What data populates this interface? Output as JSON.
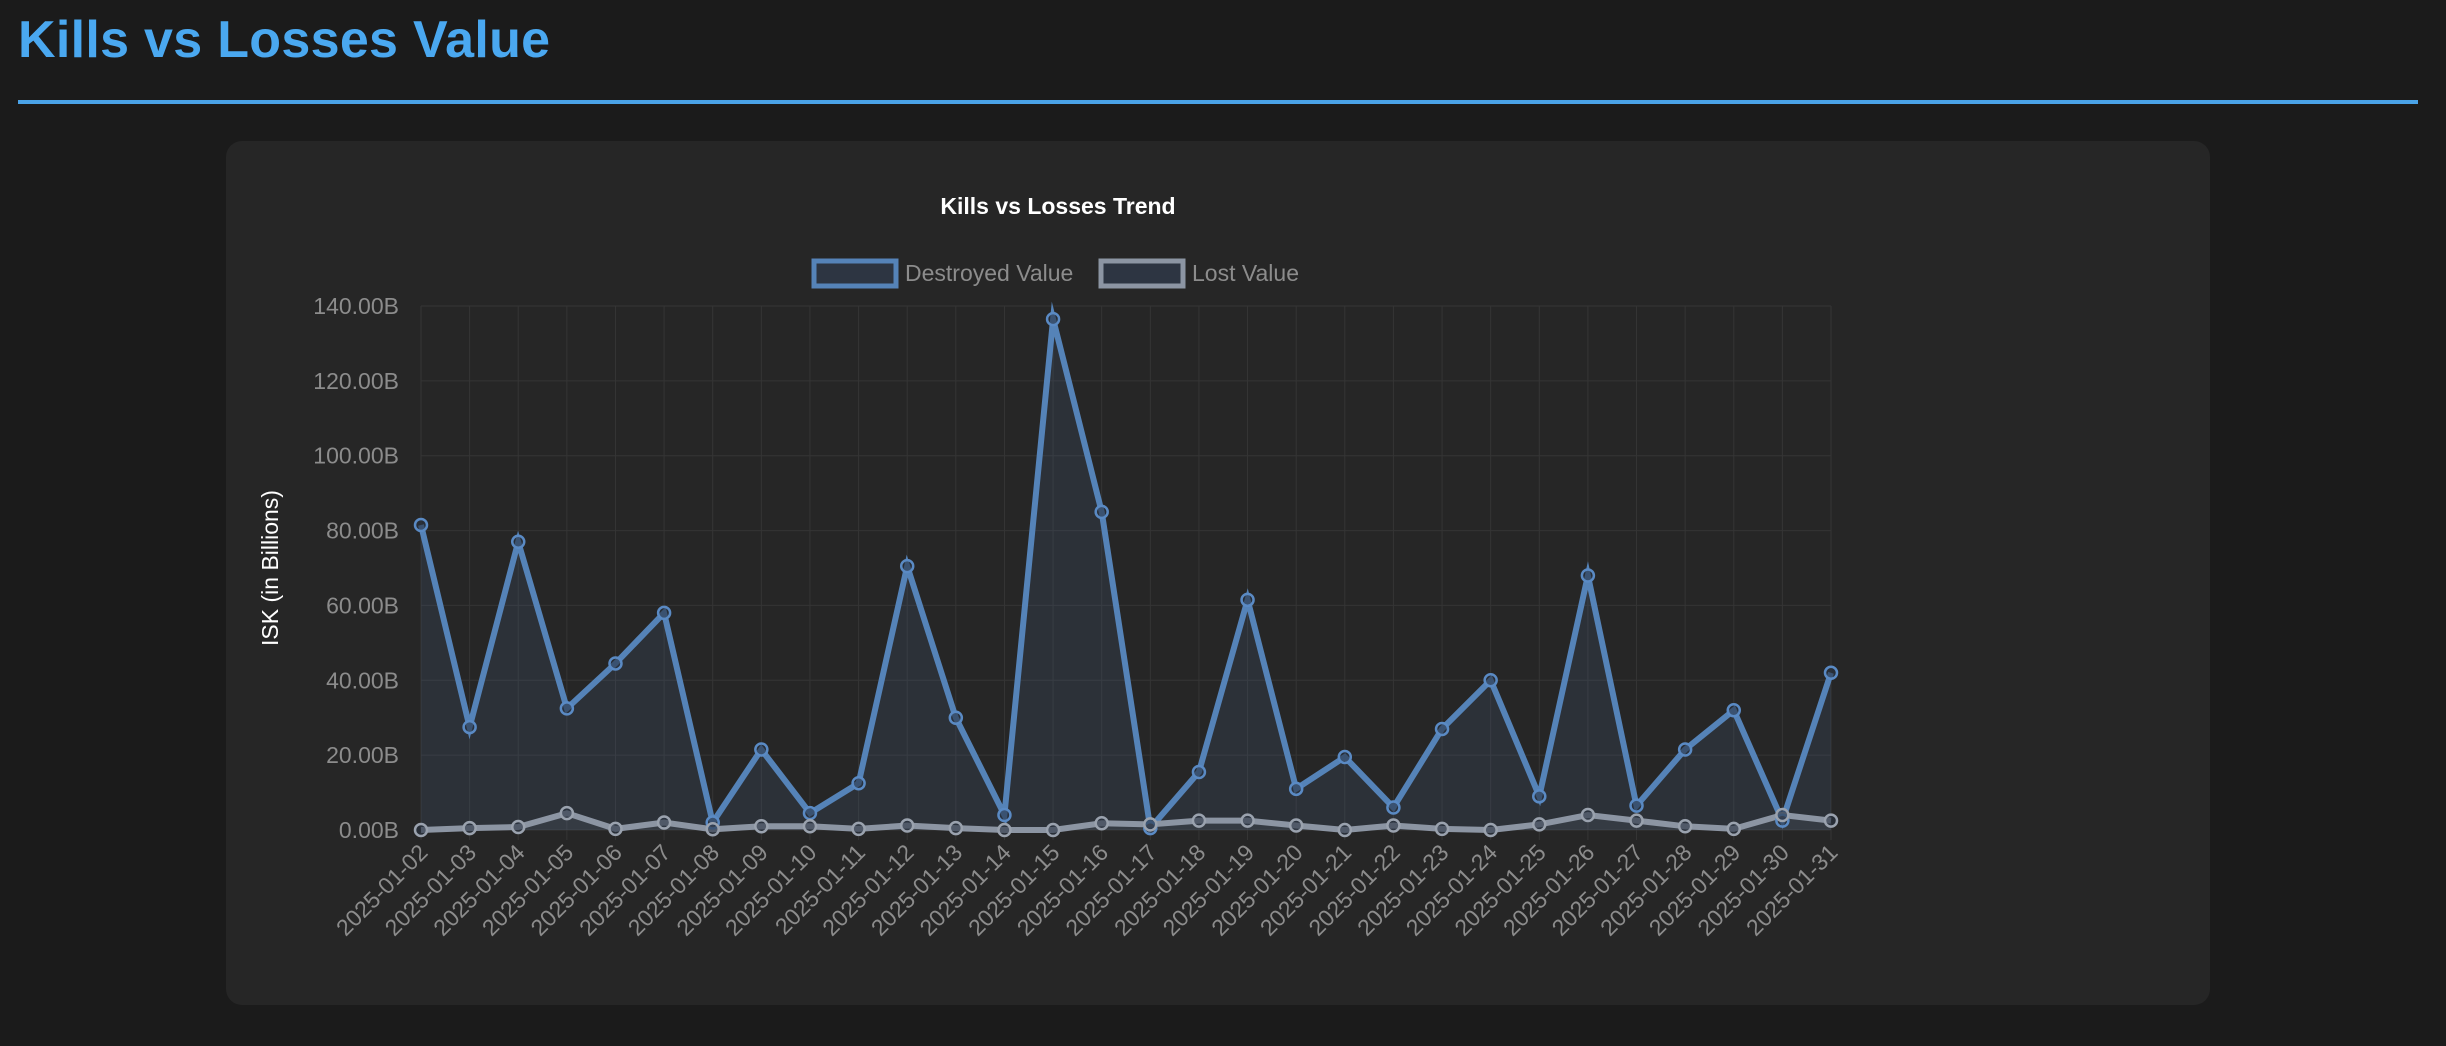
{
  "page": {
    "title": "Kills vs Losses Value"
  },
  "colors": {
    "accent": "#4aa8f0",
    "destroyed": "#5583b8",
    "lost": "#8c95a3",
    "grid": "#353535",
    "text_muted": "#8c8c8c"
  },
  "chart_data": {
    "type": "line",
    "title": "Kills vs Losses Trend",
    "xlabel": "",
    "ylabel": "ISK (in Billions)",
    "ylim": [
      0,
      140
    ],
    "y_ticks": [
      "0.00B",
      "20.00B",
      "40.00B",
      "60.00B",
      "80.00B",
      "100.00B",
      "120.00B",
      "140.00B"
    ],
    "legend_position": "top",
    "grid": true,
    "x": [
      "2025-01-02",
      "2025-01-03",
      "2025-01-04",
      "2025-01-05",
      "2025-01-06",
      "2025-01-07",
      "2025-01-08",
      "2025-01-09",
      "2025-01-10",
      "2025-01-11",
      "2025-01-12",
      "2025-01-13",
      "2025-01-14",
      "2025-01-15",
      "2025-01-16",
      "2025-01-17",
      "2025-01-18",
      "2025-01-19",
      "2025-01-20",
      "2025-01-21",
      "2025-01-22",
      "2025-01-23",
      "2025-01-24",
      "2025-01-25",
      "2025-01-26",
      "2025-01-27",
      "2025-01-28",
      "2025-01-29",
      "2025-01-30",
      "2025-01-31"
    ],
    "series": [
      {
        "name": "Destroyed Value",
        "values": [
          81.5,
          27.5,
          77.0,
          32.5,
          44.5,
          58.0,
          2.0,
          21.5,
          4.5,
          12.5,
          70.5,
          30.0,
          4.0,
          136.5,
          85.0,
          0.5,
          15.5,
          61.5,
          11.0,
          19.5,
          6.0,
          27.0,
          40.0,
          9.0,
          68.0,
          6.5,
          21.5,
          32.0,
          2.5,
          42.0
        ]
      },
      {
        "name": "Lost Value",
        "values": [
          0.0,
          0.5,
          0.8,
          4.5,
          0.3,
          2.0,
          0.2,
          1.0,
          1.0,
          0.3,
          1.2,
          0.5,
          0.0,
          0.0,
          1.8,
          1.5,
          2.5,
          2.5,
          1.2,
          0.0,
          1.2,
          0.3,
          0.0,
          1.5,
          4.0,
          2.5,
          1.0,
          0.3,
          4.0,
          2.5
        ]
      }
    ]
  }
}
